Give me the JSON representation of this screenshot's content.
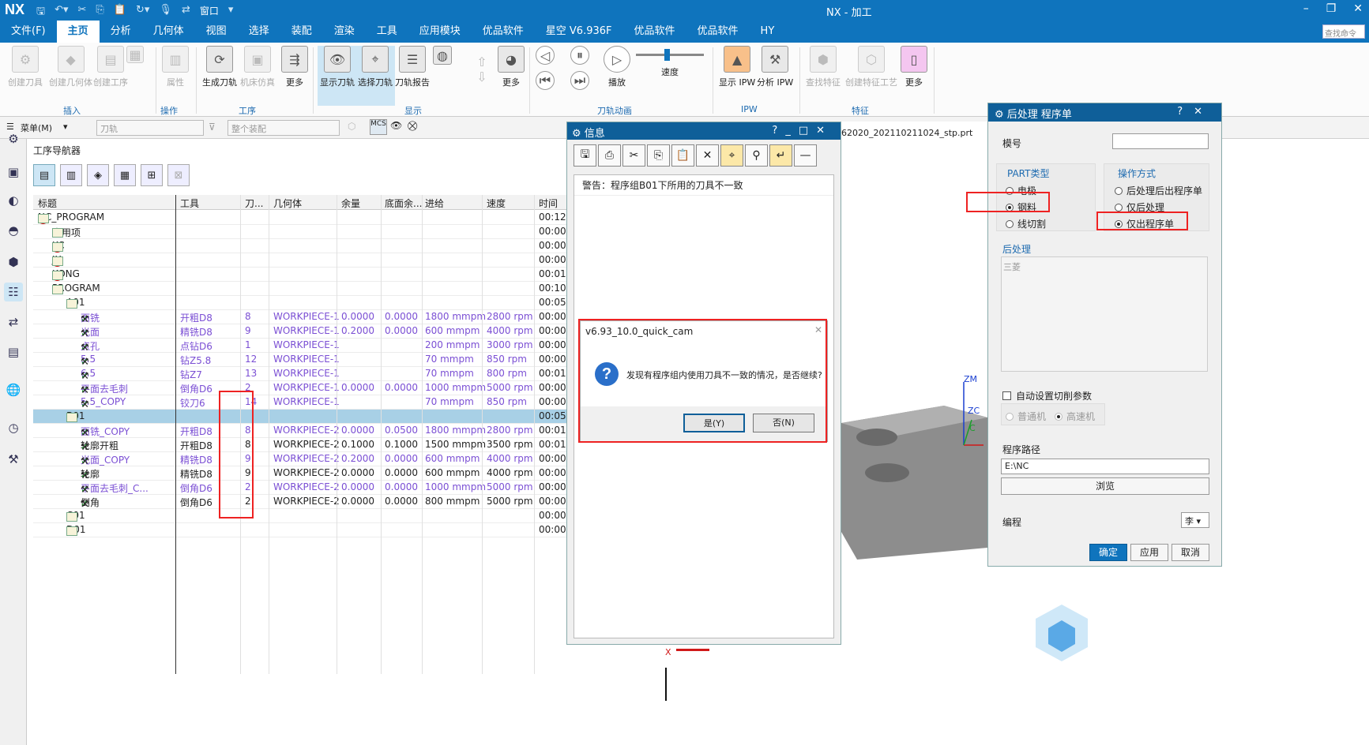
{
  "app": {
    "logo": "NX",
    "title": "NX - 加工",
    "window_label": "窗口",
    "find_command": "查找命令"
  },
  "menu": [
    "文件(F)",
    "主页",
    "分析",
    "几何体",
    "视图",
    "选择",
    "装配",
    "渲染",
    "工具",
    "应用模块",
    "优品软件",
    "星空 V6.936F",
    "优品软件",
    "优品软件",
    "HY"
  ],
  "ribbon": {
    "buttons": [
      {
        "label": "创建刀具",
        "icon": "create-tool-icon",
        "disabled": true
      },
      {
        "label": "创建几何体",
        "icon": "create-geometry-icon",
        "disabled": true
      },
      {
        "label": "创建工序",
        "icon": "create-operation-icon",
        "disabled": true
      },
      {
        "label": "属性",
        "icon": "properties-icon",
        "disabled": true
      },
      {
        "label": "生成刀轨",
        "icon": "generate-toolpath-icon",
        "disabled": false
      },
      {
        "label": "机床仿真",
        "icon": "machine-sim-icon",
        "disabled": true
      },
      {
        "label": "更多",
        "icon": "more-icon",
        "disabled": false
      },
      {
        "label": "显示刀轨",
        "icon": "show-toolpath-icon",
        "disabled": false
      },
      {
        "label": "选择刀轨",
        "icon": "select-toolpath-icon",
        "disabled": false
      },
      {
        "label": "刀轨报告",
        "icon": "toolpath-report-icon",
        "disabled": false
      },
      {
        "label": "更多",
        "icon": "more-icon",
        "disabled": false
      },
      {
        "label": "播放",
        "icon": "play-icon",
        "disabled": false
      },
      {
        "label": "速度",
        "icon": "speed-slider-icon",
        "disabled": false
      },
      {
        "label": "显示 IPW",
        "icon": "show-ipw-icon",
        "disabled": false
      },
      {
        "label": "分析 IPW",
        "icon": "analyze-ipw-icon",
        "disabled": false
      },
      {
        "label": "查找特征",
        "icon": "find-feature-icon",
        "disabled": true
      },
      {
        "label": "创建特征工艺",
        "icon": "feature-process-icon",
        "disabled": true
      },
      {
        "label": "更多",
        "icon": "more-icon",
        "disabled": false
      }
    ],
    "groups": [
      "插入",
      "操作",
      "工序",
      "显示",
      "刀轨动画",
      "IPW",
      "特征"
    ]
  },
  "selbar": {
    "menu_label": "菜单(M)",
    "filter1": "刀轨",
    "filter2": "整个装配"
  },
  "navigator": {
    "title": "工序导航器",
    "columns": [
      "标题",
      "工具",
      "刀...",
      "几何体",
      "余量",
      "底面余...",
      "进给",
      "速度",
      "时间"
    ],
    "rows": [
      {
        "name": "NC_PROGRAM",
        "tool": "",
        "num": "",
        "geo": "",
        "stock": "",
        "floor": "",
        "feed": "",
        "speed": "",
        "time": "00:12:1",
        "level": 0,
        "kind": "program-no"
      },
      {
        "name": "未用项",
        "tool": "",
        "num": "",
        "geo": "",
        "stock": "",
        "floor": "",
        "feed": "",
        "speed": "",
        "time": "00:00:0",
        "level": 1,
        "kind": "folder"
      },
      {
        "name": "KC",
        "tool": "",
        "num": "",
        "geo": "",
        "stock": "",
        "floor": "",
        "feed": "",
        "speed": "",
        "time": "00:00:1",
        "level": 1,
        "kind": "program-no"
      },
      {
        "name": "JX",
        "tool": "",
        "num": "",
        "geo": "",
        "stock": "",
        "floor": "",
        "feed": "",
        "speed": "",
        "time": "00:00:1",
        "level": 1,
        "kind": "program-no"
      },
      {
        "name": "KONG",
        "tool": "",
        "num": "",
        "geo": "",
        "stock": "",
        "floor": "",
        "feed": "",
        "speed": "",
        "time": "00:01:0",
        "level": 1,
        "kind": "program-no"
      },
      {
        "name": "PROGRAM",
        "tool": "",
        "num": "",
        "geo": "",
        "stock": "",
        "floor": "",
        "feed": "",
        "speed": "",
        "time": "00:10:5",
        "level": 1,
        "kind": "folder"
      },
      {
        "name": "A01",
        "tool": "",
        "num": "",
        "geo": "",
        "stock": "",
        "floor": "",
        "feed": "",
        "speed": "",
        "time": "00:05:1",
        "level": 2,
        "kind": "check-folder"
      },
      {
        "name": "面铣",
        "tool": "开粗D8",
        "num": "8",
        "geo": "WORKPIECE-1",
        "stock": "0.0000",
        "floor": "0.0000",
        "feed": "1800 mmpm",
        "speed": "2800 rpm",
        "time": "00:00:1",
        "level": 3,
        "kind": "op",
        "purple": true
      },
      {
        "name": "光面",
        "tool": "精铣D8",
        "num": "9",
        "geo": "WORKPIECE-1",
        "stock": "0.2000",
        "floor": "0.0000",
        "feed": "600 mmpm",
        "speed": "4000 rpm",
        "time": "00:00:5",
        "level": 3,
        "kind": "op",
        "purple": true
      },
      {
        "name": "点孔",
        "tool": "点钻D6",
        "num": "1",
        "geo": "WORKPIECE-1",
        "stock": "",
        "floor": "",
        "feed": "200 mmpm",
        "speed": "3000 rpm",
        "time": "00:00:0",
        "level": 3,
        "kind": "op",
        "purple": true
      },
      {
        "name": "5.5",
        "tool": "钻Z5.8",
        "num": "12",
        "geo": "WORKPIECE-1",
        "stock": "",
        "floor": "",
        "feed": "70 mmpm",
        "speed": "850 rpm",
        "time": "00:00:2",
        "level": 3,
        "kind": "op",
        "purple": true
      },
      {
        "name": "6.5",
        "tool": "钻Z7",
        "num": "13",
        "geo": "WORKPIECE-1",
        "stock": "",
        "floor": "",
        "feed": "70 mmpm",
        "speed": "800 rpm",
        "time": "00:01:2",
        "level": 3,
        "kind": "op",
        "purple": true
      },
      {
        "name": "平面去毛刺",
        "tool": "倒角D6",
        "num": "2",
        "geo": "WORKPIECE-1",
        "stock": "0.0000",
        "floor": "0.0000",
        "feed": "1000 mmpm",
        "speed": "5000 rpm",
        "time": "00:00:2",
        "level": 3,
        "kind": "op",
        "purple": true
      },
      {
        "name": "5.5_COPY",
        "tool": "铰刀6",
        "num": "14",
        "geo": "WORKPIECE-1",
        "stock": "",
        "floor": "",
        "feed": "70 mmpm",
        "speed": "850 rpm",
        "time": "00:00:2",
        "level": 3,
        "kind": "op",
        "purple": true
      },
      {
        "name": "B01",
        "tool": "",
        "num": "",
        "geo": "",
        "stock": "",
        "floor": "",
        "feed": "",
        "speed": "",
        "time": "00:05:3",
        "level": 2,
        "kind": "folder",
        "selected": true
      },
      {
        "name": "面铣_COPY",
        "tool": "开粗D8",
        "num": "8",
        "geo": "WORKPIECE-2",
        "stock": "0.0000",
        "floor": "0.0500",
        "feed": "1800 mmpm",
        "speed": "2800 rpm",
        "time": "00:01:3",
        "level": 3,
        "kind": "op",
        "purple": true
      },
      {
        "name": "轮廓开粗",
        "tool": "开粗D8",
        "num": "8",
        "geo": "WORKPIECE-2",
        "stock": "0.1000",
        "floor": "0.1000",
        "feed": "1500 mmpm",
        "speed": "3500 rpm",
        "time": "00:01:4",
        "level": 3,
        "kind": "op",
        "purple": false
      },
      {
        "name": "光面_COPY",
        "tool": "精铣D8",
        "num": "9",
        "geo": "WORKPIECE-2",
        "stock": "0.2000",
        "floor": "0.0000",
        "feed": "600 mmpm",
        "speed": "4000 rpm",
        "time": "00:00:5",
        "level": 3,
        "kind": "op",
        "purple": true
      },
      {
        "name": "轮廓",
        "tool": "精铣D8",
        "num": "9",
        "geo": "WORKPIECE-2",
        "stock": "0.0000",
        "floor": "0.0000",
        "feed": "600 mmpm",
        "speed": "4000 rpm",
        "time": "00:00:2",
        "level": 3,
        "kind": "op",
        "purple": false
      },
      {
        "name": "平面去毛刺_C...",
        "tool": "倒角D6",
        "num": "2",
        "geo": "WORKPIECE-2",
        "stock": "0.0000",
        "floor": "0.0000",
        "feed": "1000 mmpm",
        "speed": "5000 rpm",
        "time": "00:00:1",
        "level": 3,
        "kind": "op",
        "purple": true
      },
      {
        "name": "倒角",
        "tool": "倒角D6",
        "num": "2",
        "geo": "WORKPIECE-2",
        "stock": "0.0000",
        "floor": "0.0000",
        "feed": "800 mmpm",
        "speed": "5000 rpm",
        "time": "00:00:0",
        "level": 3,
        "kind": "op",
        "purple": false
      },
      {
        "name": "C01",
        "tool": "",
        "num": "",
        "geo": "",
        "stock": "",
        "floor": "",
        "feed": "",
        "speed": "",
        "time": "00:00:0",
        "level": 2,
        "kind": "folder"
      },
      {
        "name": "D01",
        "tool": "",
        "num": "",
        "geo": "",
        "stock": "",
        "floor": "",
        "feed": "",
        "speed": "",
        "time": "00:00:0",
        "level": 2,
        "kind": "check-folder"
      }
    ]
  },
  "info_window": {
    "title": "信息",
    "message": "警告：程序组B01下所用的刀具不一致"
  },
  "modal": {
    "title": "v6.93_10.0_quick_cam",
    "message": "发现有程序组内使用刀具不一致的情况，是否继续?",
    "yes": "是(Y)",
    "no": "否(N)"
  },
  "viewport": {
    "file_tab": "62020_20211021​1024_stp.prt",
    "axis_zm": "ZM",
    "axis_z": "ZC",
    "axis_c": "C",
    "axis_x": "X"
  },
  "post_window": {
    "title": "后处理 程序单",
    "model_no_label": "模号",
    "model_no_value": "",
    "part_type_label": "PART类型",
    "part_types": [
      {
        "label": "电极",
        "checked": false
      },
      {
        "label": "钢料",
        "checked": true
      },
      {
        "label": "线切割",
        "checked": false
      }
    ],
    "op_mode_label": "操作方式",
    "op_modes": [
      {
        "label": "后处理后出程序单",
        "checked": false
      },
      {
        "label": "仅后处理",
        "checked": false
      },
      {
        "label": "仅出程序单",
        "checked": true
      }
    ],
    "post_section": "后处理",
    "post_item": "三菱",
    "auto_cut_label": "自动设置切削参数",
    "machine_normal": "普通机",
    "machine_high": "高速机",
    "path_label": "程序路径",
    "path_value": "E:\\NC",
    "browse": "浏览",
    "programmer_label": "编程",
    "programmer_value": "李",
    "ok": "确定",
    "apply": "应用",
    "cancel": "取消"
  }
}
